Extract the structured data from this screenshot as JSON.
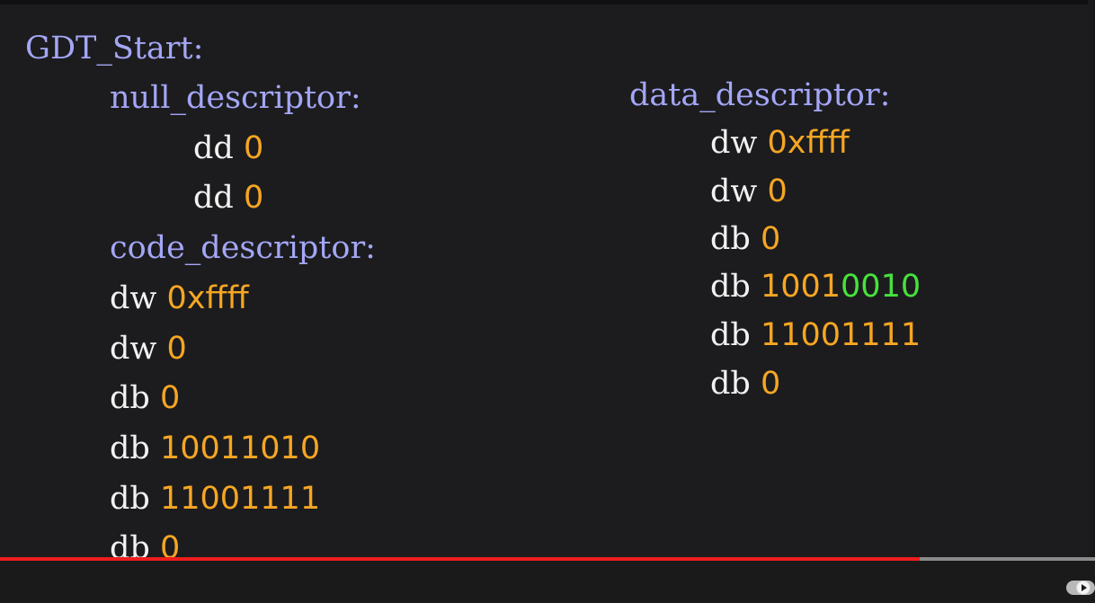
{
  "code": {
    "left_column": {
      "gdt_start": "GDT_Start:",
      "null_descriptor": {
        "label": "null_descriptor:",
        "lines": [
          {
            "op": "dd",
            "value": "0"
          },
          {
            "op": "dd",
            "value": "0"
          }
        ]
      },
      "code_descriptor": {
        "label": "code_descriptor:",
        "lines": [
          {
            "op": "dw",
            "value": "0xffff"
          },
          {
            "op": "dw",
            "value": "0"
          },
          {
            "op": "db",
            "value": "0"
          },
          {
            "op": "db",
            "value": "10011010"
          },
          {
            "op": "db",
            "value": "11001111"
          },
          {
            "op": "db",
            "value": "0"
          }
        ]
      }
    },
    "right_column": {
      "data_descriptor": {
        "label": "data_descriptor:",
        "lines": [
          {
            "op": "dw",
            "value": "0xffff"
          },
          {
            "op": "dw",
            "value": "0"
          },
          {
            "op": "db",
            "value": "0"
          },
          {
            "op": "db",
            "value_orange": "1001",
            "value_green": "0010"
          },
          {
            "op": "db",
            "value": "11001111"
          },
          {
            "op": "db",
            "value": "0"
          }
        ]
      }
    }
  },
  "player": {
    "progress_fraction": 0.84,
    "autoplay_toggle": "on"
  },
  "colors": {
    "background": "#1c1c1e",
    "label": "#a4a6f6",
    "keyword": "#f2f2f2",
    "number": "#f6a623",
    "highlight_green": "#46e23c",
    "progress_played": "#ee1c1c",
    "progress_track": "#8a8a8a"
  }
}
